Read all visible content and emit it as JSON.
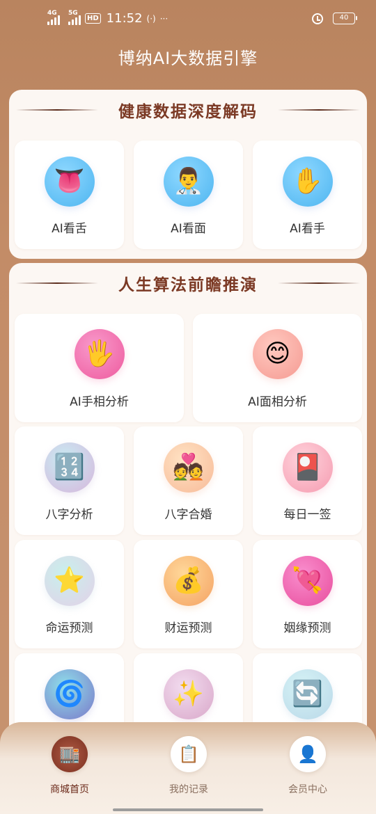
{
  "status": {
    "net1": "4G",
    "net2": "5G",
    "hd": "HD",
    "time": "11:52",
    "nfc": "(·)",
    "more": "···",
    "battery": "40"
  },
  "app_title": "博纳AI大数据引擎",
  "health": {
    "title": "健康数据深度解码",
    "items": [
      {
        "label": "AI看舌",
        "icon": "👅",
        "icon_name": "tongue-icon"
      },
      {
        "label": "AI看面",
        "icon": "👨‍⚕️",
        "icon_name": "doctor-face-icon"
      },
      {
        "label": "AI看手",
        "icon": "✋",
        "icon_name": "hand-icon"
      }
    ]
  },
  "life": {
    "title": "人生算法前瞻推演",
    "items": [
      {
        "label": "AI手相分析",
        "icon": "🖐️",
        "icon_name": "palm-icon"
      },
      {
        "label": "AI面相分析",
        "icon": "😊",
        "icon_name": "smiling-face-icon"
      },
      {
        "label": "八字分析",
        "icon": "🔢",
        "icon_name": "numbers-icon"
      },
      {
        "label": "八字合婚",
        "icon": "💑",
        "icon_name": "couple-icon"
      },
      {
        "label": "每日一签",
        "icon": "🎴",
        "icon_name": "flower-card-icon"
      },
      {
        "label": "命运预测",
        "icon": "⭐",
        "icon_name": "star-icon"
      },
      {
        "label": "财运预测",
        "icon": "💰",
        "icon_name": "money-bag-icon"
      },
      {
        "label": "姻缘预测",
        "icon": "💘",
        "icon_name": "heart-arrow-icon"
      },
      {
        "label": "",
        "icon": "🌀",
        "icon_name": "cyclone-icon"
      },
      {
        "label": "",
        "icon": "✨",
        "icon_name": "sparkles-icon"
      },
      {
        "label": "",
        "icon": "🔄",
        "icon_name": "refresh-arrows-icon"
      }
    ]
  },
  "nav": {
    "items": [
      {
        "label": "商城首页",
        "icon": "🏬",
        "icon_name": "store-icon",
        "active": true
      },
      {
        "label": "我的记录",
        "icon": "📋",
        "icon_name": "clipboard-icon",
        "active": false
      },
      {
        "label": "会员中心",
        "icon": "👤",
        "icon_name": "user-icon",
        "active": false
      }
    ]
  },
  "colors": {
    "background": "#c08a67",
    "title_text": "#7b3924",
    "tongue_bg": "#6cc3f4",
    "hand_pink_bg": "#f06aa8"
  }
}
